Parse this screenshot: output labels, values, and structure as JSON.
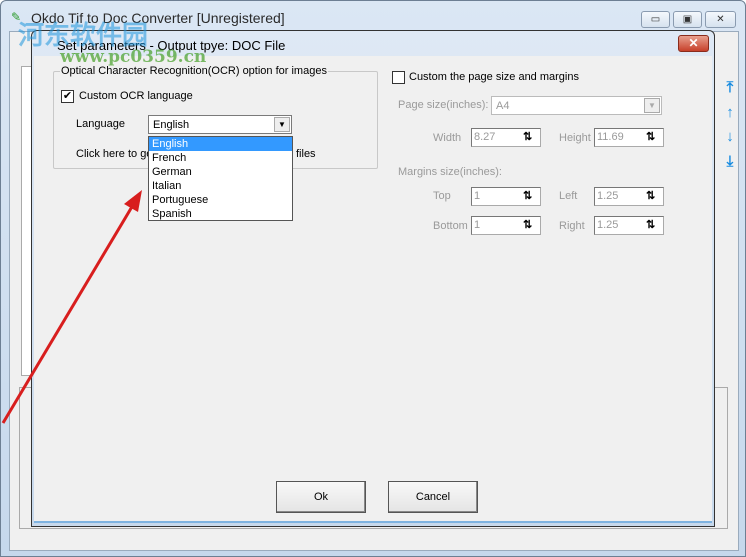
{
  "main_window": {
    "title": "Okdo Tif to Doc Converter [Unregistered]",
    "caption_buttons": [
      "minimize",
      "maximize",
      "close"
    ]
  },
  "watermark": {
    "line1": "河东软件园",
    "line2": "www.pc0359.cn"
  },
  "dialog": {
    "title": "Set parameters - Output tpye: DOC File",
    "ocr_group": {
      "title": "Optical Character Recognition(OCR) option for images",
      "custom_ocr_label": "Custom OCR language",
      "custom_ocr_checked": true,
      "language_label": "Language",
      "language_value": "English",
      "language_options": [
        "English",
        "French",
        "German",
        "Italian",
        "Portuguese",
        "Spanish"
      ],
      "click_here_prefix": "Click here to ge",
      "click_here_suffix": "files"
    },
    "page": {
      "custom_label": "Custom the page size and margins",
      "custom_checked": false,
      "page_size_label": "Page size(inches):",
      "page_size_value": "A4",
      "width_label": "Width",
      "width_value": "8.27",
      "height_label": "Height",
      "height_value": "11.69",
      "margins_label": "Margins size(inches):",
      "top_label": "Top",
      "top_value": "1",
      "left_label": "Left",
      "left_value": "1.25",
      "bottom_label": "Bottom",
      "bottom_value": "1",
      "right_label": "Right",
      "right_value": "1.25"
    },
    "ok_label": "Ok",
    "cancel_label": "Cancel"
  },
  "colors": {
    "selection": "#3399ff",
    "annotation_arrow": "#d81e1e",
    "accent_icons": "#1a8de0"
  }
}
